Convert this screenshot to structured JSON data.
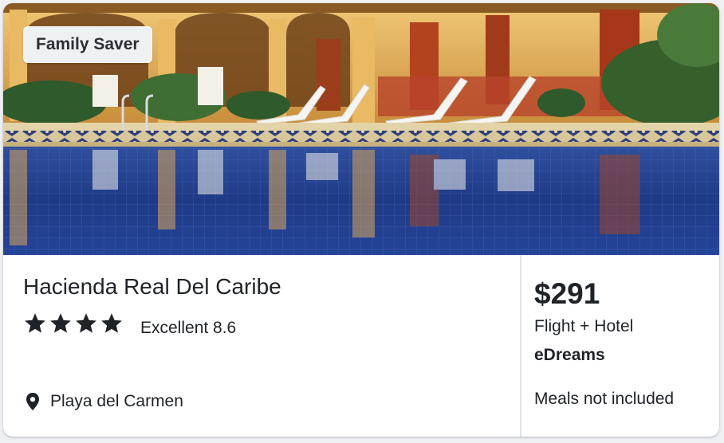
{
  "badge": {
    "label": "Family Saver"
  },
  "hotel": {
    "name": "Hacienda Real Del Caribe",
    "stars": 4,
    "rating_text": "Excellent 8.6",
    "location": "Playa del Carmen"
  },
  "offer": {
    "price": "$291",
    "package": "Flight + Hotel",
    "provider": "eDreams",
    "meals": "Meals not included"
  },
  "icons": {
    "star": "star-icon",
    "location": "location-pin-icon"
  },
  "colors": {
    "text": "#1f2328",
    "badge_bg": "#eef1f4",
    "divider": "#dde2e8",
    "pool": "#243f8e",
    "wall": "#e7b75a"
  }
}
